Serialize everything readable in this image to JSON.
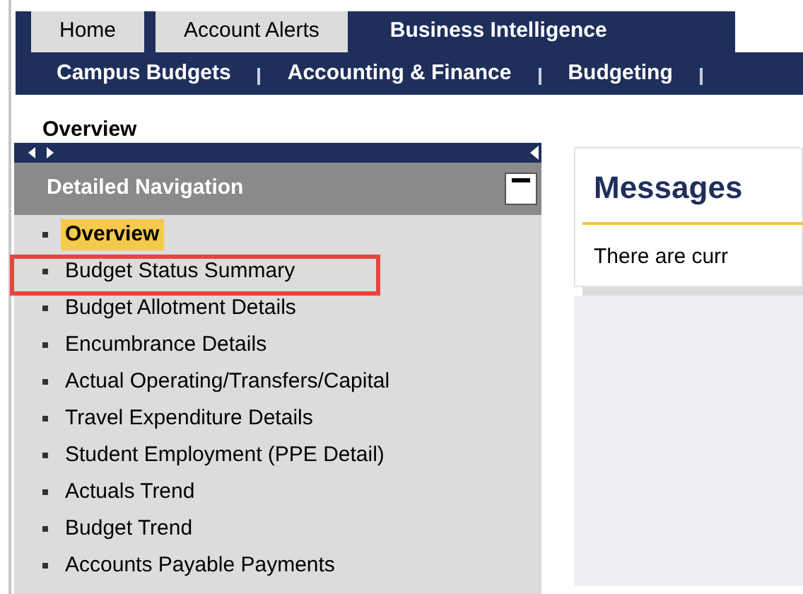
{
  "tabs": [
    {
      "label": "Home",
      "selected": false
    },
    {
      "label": "Account Alerts",
      "selected": false
    },
    {
      "label": "Business Intelligence",
      "selected": true
    }
  ],
  "subnav": [
    "Campus Budgets",
    "Accounting & Finance",
    "Budgeting"
  ],
  "page_title": "Overview",
  "navigation": {
    "title": "Detailed Navigation",
    "expanded": true,
    "items": [
      {
        "label": "Overview",
        "selected": true,
        "annotated": false
      },
      {
        "label": "Budget Status Summary",
        "selected": false,
        "annotated": true
      },
      {
        "label": "Budget Allotment Details",
        "selected": false,
        "annotated": false
      },
      {
        "label": "Encumbrance Details",
        "selected": false,
        "annotated": false
      },
      {
        "label": "Actual Operating/Transfers/Capital",
        "selected": false,
        "annotated": false
      },
      {
        "label": "Travel Expenditure Details",
        "selected": false,
        "annotated": false
      },
      {
        "label": "Student Employment (PPE Detail)",
        "selected": false,
        "annotated": false
      },
      {
        "label": "Actuals Trend",
        "selected": false,
        "annotated": false
      },
      {
        "label": "Budget Trend",
        "selected": false,
        "annotated": false
      },
      {
        "label": "Accounts Payable Payments",
        "selected": false,
        "annotated": false
      }
    ]
  },
  "messages": {
    "title": "Messages",
    "text": "There are curr"
  }
}
